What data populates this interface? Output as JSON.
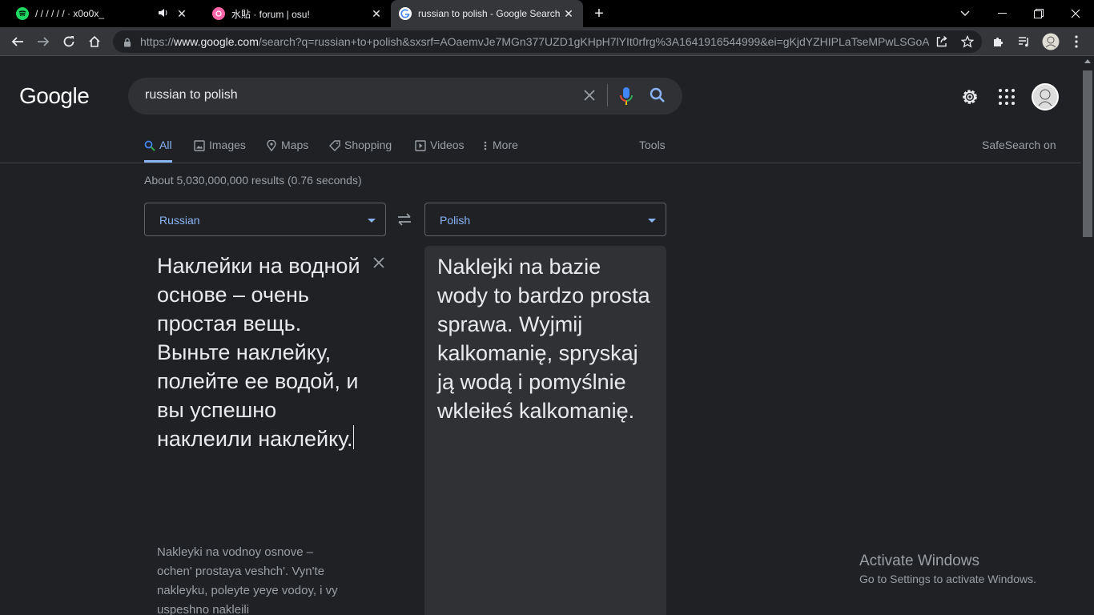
{
  "browser": {
    "tabs": [
      {
        "title": "/ / / / / / · x0o0x_",
        "icon": "spotify-icon",
        "color": "#1ed760"
      },
      {
        "title": "水貼 · forum | osu!",
        "icon": "osu-icon",
        "color": "#ff66aa"
      },
      {
        "title": "russian to polish - Google Search",
        "icon": "google-icon",
        "color": "#4285f4"
      }
    ],
    "url_host": "www.google.com",
    "url_prefix": "https://",
    "url_path": "/search?q=russian+to+polish&sxsrf=AOaemvJe7MGn377UZD1gKHpH7lYIt0rfrg%3A1641916544999&ei=gKjdYZHIPLaTseMPwLSGoA..."
  },
  "search": {
    "query": "russian to polish"
  },
  "nav": {
    "all": "All",
    "images": "Images",
    "maps": "Maps",
    "shopping": "Shopping",
    "videos": "Videos",
    "more": "More",
    "tools": "Tools",
    "safesearch": "SafeSearch on"
  },
  "stats": "About 5,030,000,000 results (0.76 seconds)",
  "translate": {
    "source_lang": "Russian",
    "target_lang": "Polish",
    "source_text": "Наклейки на водной основе – очень простая вещь. Выньте наклейку, полейте ее водой, и вы успешно наклеили наклейку.",
    "transliteration": "Nakleyki na vodnoy osnove – ochen' prostaya veshch'. Vyn'te nakleyku, poleyte yeye vodoy, i vy uspeshno nakleili",
    "target_text": "Naklejki na bazie wody to bardzo prosta sprawa. Wyjmij kalkomanię, spryskaj ją wodą i pomyślnie wkleiłeś kalkomanię."
  },
  "watermark": {
    "title": "Activate Windows",
    "subtitle": "Go to Settings to activate Windows."
  },
  "colors": {
    "accent": "#8ab4f8",
    "background": "#202124"
  }
}
